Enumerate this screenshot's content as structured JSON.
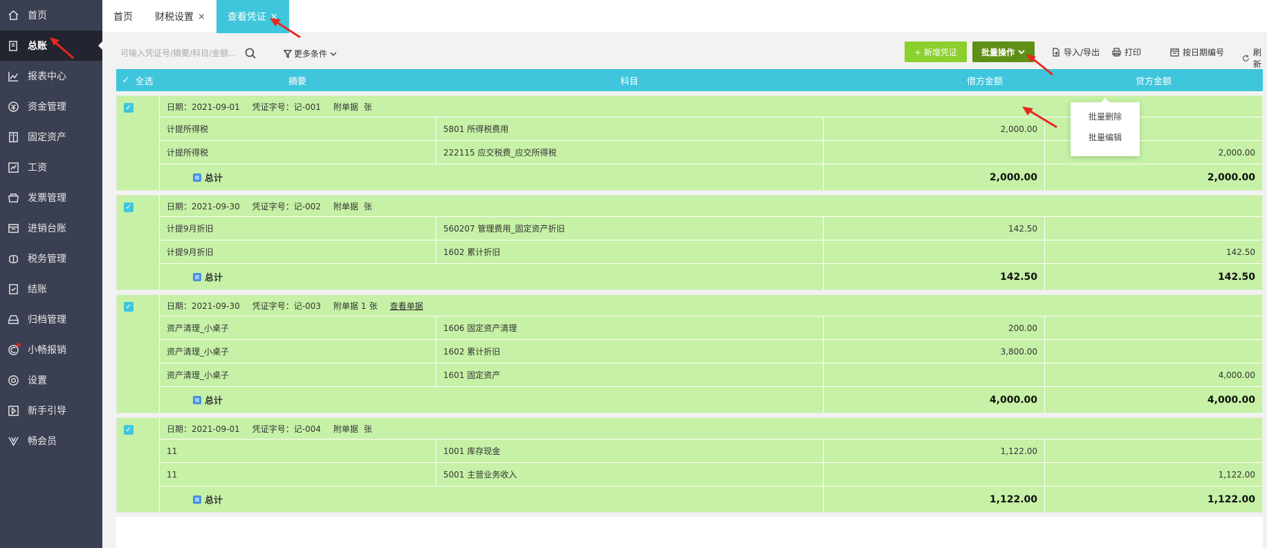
{
  "sidebar": {
    "items": [
      {
        "label": "首页",
        "icon": "home-icon"
      },
      {
        "label": "总账",
        "icon": "ledger-icon",
        "active": true
      },
      {
        "label": "报表中心",
        "icon": "chart-icon"
      },
      {
        "label": "资金管理",
        "icon": "money-icon"
      },
      {
        "label": "固定资产",
        "icon": "building-icon"
      },
      {
        "label": "工资",
        "icon": "payroll-icon"
      },
      {
        "label": "发票管理",
        "icon": "invoice-icon"
      },
      {
        "label": "进销台账",
        "icon": "inventory-icon"
      },
      {
        "label": "税务管理",
        "icon": "tax-icon"
      },
      {
        "label": "结账",
        "icon": "checkout-icon"
      },
      {
        "label": "归档管理",
        "icon": "archive-icon"
      },
      {
        "label": "小畅报销",
        "icon": "reimburse-icon"
      },
      {
        "label": "设置",
        "icon": "gear-icon"
      },
      {
        "label": "新手引导",
        "icon": "guide-icon"
      },
      {
        "label": "畅会员",
        "icon": "member-icon"
      }
    ]
  },
  "tabs": [
    {
      "label": "首页",
      "closable": false
    },
    {
      "label": "财税设置",
      "closable": true
    },
    {
      "label": "查看凭证",
      "closable": true,
      "active": true
    }
  ],
  "tab_close_glyph": "×",
  "toolbar": {
    "search_placeholder": "可输入凭证号/摘要/科目/金额...",
    "more_conditions": "更多条件",
    "new_voucher": "+ 新增凭证",
    "batch_ops": "批量操作",
    "import_export": "导入/导出",
    "print": "打印",
    "renumber_by_date": "按日期编号",
    "refresh": "刷新"
  },
  "dropdown": {
    "items": [
      "批量删除",
      "批量编辑"
    ]
  },
  "grid_header": {
    "check_glyph": "✓",
    "select_all": "全选",
    "summary": "摘要",
    "subject": "科目",
    "debit": "借方金额",
    "credit": "贷方金额"
  },
  "labels": {
    "date": "日期：",
    "voucher_no": "凭证字号：",
    "attachments": "附单据",
    "unit": "张",
    "view_attachment": "查看单据",
    "total": "总计"
  },
  "vouchers": [
    {
      "date": "2021-09-01",
      "no": "记-001",
      "attach_count": "",
      "has_view": false,
      "entries": [
        {
          "summary": "计提所得税",
          "subject": "5801 所得税费用",
          "debit": "2,000.00",
          "credit": ""
        },
        {
          "summary": "计提所得税",
          "subject": "222115 应交税费_应交所得税",
          "debit": "",
          "credit": "2,000.00"
        }
      ],
      "total_debit": "2,000.00",
      "total_credit": "2,000.00"
    },
    {
      "date": "2021-09-30",
      "no": "记-002",
      "attach_count": "",
      "has_view": false,
      "entries": [
        {
          "summary": "计提9月折旧",
          "subject": "560207 管理费用_固定资产折旧",
          "debit": "142.50",
          "credit": ""
        },
        {
          "summary": "计提9月折旧",
          "subject": "1602 累计折旧",
          "debit": "",
          "credit": "142.50"
        }
      ],
      "total_debit": "142.50",
      "total_credit": "142.50"
    },
    {
      "date": "2021-09-30",
      "no": "记-003",
      "attach_count": "1",
      "has_view": true,
      "entries": [
        {
          "summary": "资产清理_小桌子",
          "subject": "1606 固定资产清理",
          "debit": "200.00",
          "credit": ""
        },
        {
          "summary": "资产清理_小桌子",
          "subject": "1602 累计折旧",
          "debit": "3,800.00",
          "credit": ""
        },
        {
          "summary": "资产清理_小桌子",
          "subject": "1601 固定资产",
          "debit": "",
          "credit": "4,000.00"
        }
      ],
      "total_debit": "4,000.00",
      "total_credit": "4,000.00"
    },
    {
      "date": "2021-09-01",
      "no": "记-004",
      "attach_count": "",
      "has_view": false,
      "entries": [
        {
          "summary": "11",
          "subject": "1001 库存现金",
          "debit": "1,122.00",
          "credit": ""
        },
        {
          "summary": "11",
          "subject": "5001 主营业务收入",
          "debit": "",
          "credit": "1,122.00"
        }
      ],
      "total_debit": "1,122.00",
      "total_credit": "1,122.00"
    }
  ],
  "colors": {
    "sidebar_bg": "#3a3f51",
    "accent": "#3fc5dc",
    "row_bg": "#c6f1a6",
    "new_btn": "#8bd02c",
    "batch_btn": "#5f8f14",
    "annotation": "#e8271f"
  }
}
